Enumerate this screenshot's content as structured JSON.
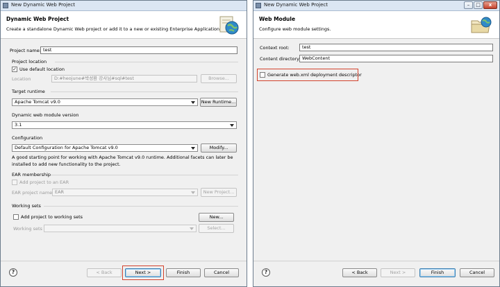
{
  "left": {
    "window_title": "New Dynamic Web Project",
    "banner": {
      "title": "Dynamic Web Project",
      "description": "Create a standalone Dynamic Web project or add it to a new or existing Enterprise Application."
    },
    "project_name_label": "Project name:",
    "project_name_value": "test",
    "project_location": {
      "group_label": "Project location",
      "use_default_label": "Use default location",
      "use_default_checked": true,
      "location_label": "Location",
      "location_value": "D:#heojune#박성환 강사님#sql#test",
      "browse_label": "Browse..."
    },
    "target_runtime": {
      "group_label": "Target runtime",
      "selected": "Apache Tomcat v9.0",
      "new_runtime_label": "New Runtime..."
    },
    "module_version": {
      "group_label": "Dynamic web module version",
      "selected": "3.1"
    },
    "configuration": {
      "group_label": "Configuration",
      "selected": "Default Configuration for Apache Tomcat v9.0",
      "modify_label": "Modify...",
      "description_line1": "A good starting point for working with Apache Tomcat v9.0 runtime. Additional facets can later be",
      "description_line2": "installed to add new functionality to the project."
    },
    "ear_membership": {
      "group_label": "EAR membership",
      "add_to_ear_label": "Add project to an EAR",
      "add_to_ear_checked": false,
      "ear_project_name_label": "EAR project name",
      "ear_project_name_value": "EAR",
      "new_project_label": "New Project..."
    },
    "working_sets": {
      "group_label": "Working sets",
      "add_to_ws_label": "Add project to working sets",
      "add_to_ws_checked": false,
      "new_label": "New...",
      "working_sets_label": "Working sets",
      "working_sets_value": "",
      "select_label": "Select..."
    },
    "footer": {
      "help_icon_text": "?",
      "back_label": "< Back",
      "next_label": "Next >",
      "finish_label": "Finish",
      "cancel_label": "Cancel"
    }
  },
  "right": {
    "window_title": "New Dynamic Web Project",
    "banner": {
      "title": "Web Module",
      "description": "Configure web module settings."
    },
    "context_root_label": "Context root:",
    "context_root_value": "test",
    "content_directory_label": "Content directory:",
    "content_directory_value": "WebContent",
    "generate_xml_label": "Generate web.xml deployment descriptor",
    "generate_xml_checked": false,
    "footer": {
      "help_icon_text": "?",
      "back_label": "< Back",
      "next_label": "Next >",
      "finish_label": "Finish",
      "cancel_label": "Cancel"
    }
  },
  "window_controls": {
    "minimize": "–",
    "maximize": "□",
    "close": "x"
  },
  "colors": {
    "highlight": "#d2412b",
    "titlebar": "#dbe6f3",
    "dialog_bg": "#f0f0f0"
  }
}
